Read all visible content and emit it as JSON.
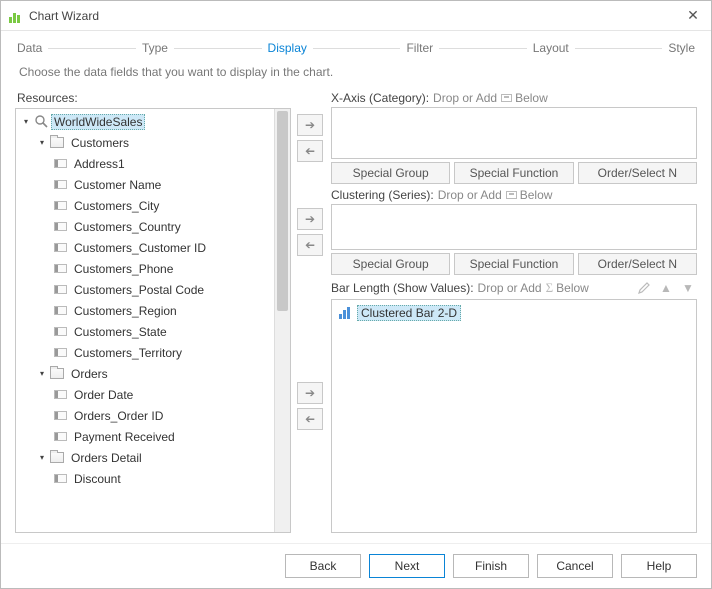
{
  "window": {
    "title": "Chart Wizard"
  },
  "steps": [
    "Data",
    "Type",
    "Display",
    "Filter",
    "Layout",
    "Style"
  ],
  "active_step_index": 2,
  "subtitle": "Choose the data fields that you want to display in the chart.",
  "resources": {
    "label": "Resources:",
    "root": {
      "label": "WorldWideSales",
      "expanded": true
    },
    "groups": [
      {
        "label": "Customers",
        "expanded": true,
        "fields": [
          "Address1",
          "Customer Name",
          "Customers_City",
          "Customers_Country",
          "Customers_Customer ID",
          "Customers_Phone",
          "Customers_Postal Code",
          "Customers_Region",
          "Customers_State",
          "Customers_Territory"
        ]
      },
      {
        "label": "Orders",
        "expanded": true,
        "fields": [
          "Order Date",
          "Orders_Order ID",
          "Payment Received"
        ]
      },
      {
        "label": "Orders Detail",
        "expanded": true,
        "fields": [
          "Discount"
        ]
      }
    ]
  },
  "xaxis": {
    "label": "X-Axis (Category):",
    "hint": "Drop or Add",
    "below": "Below",
    "buttons": [
      "Special Group",
      "Special Function",
      "Order/Select N"
    ]
  },
  "clustering": {
    "label": "Clustering (Series):",
    "hint": "Drop or Add",
    "below": "Below",
    "buttons": [
      "Special Group",
      "Special Function",
      "Order/Select N"
    ]
  },
  "barlength": {
    "label": "Bar Length (Show Values):",
    "hint": "Drop or Add",
    "below": "Below",
    "item": "Clustered Bar 2-D"
  },
  "footer": {
    "back": "Back",
    "next": "Next",
    "finish": "Finish",
    "cancel": "Cancel",
    "help": "Help"
  }
}
